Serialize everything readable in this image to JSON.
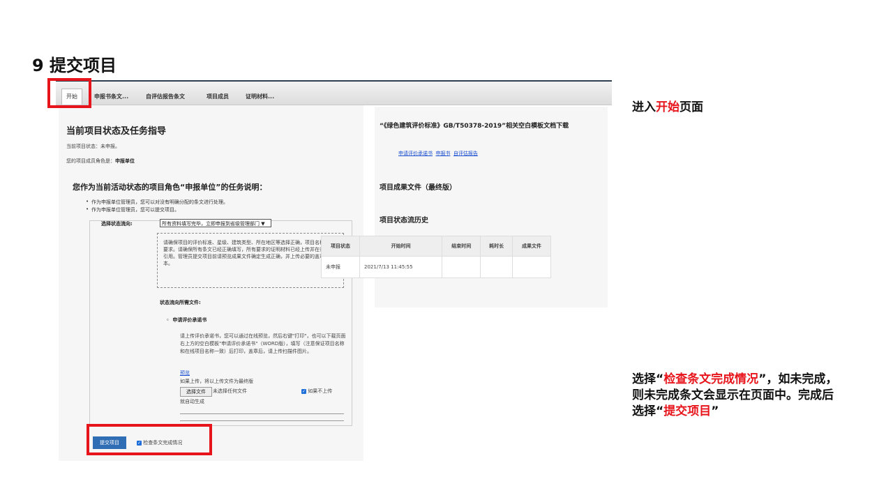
{
  "slide": {
    "title": "9 提交项目",
    "caption_top": {
      "before": "进入",
      "highlight": "开始",
      "after": "页面"
    },
    "caption_bottom": {
      "p1": "选择“",
      "h1": "检查条文完成情况",
      "p2": "”，如未完成，则未完成条文会显示在页面中。完成后选择“",
      "h2": "提交项目",
      "p3": "”"
    }
  },
  "tabs": [
    "开始",
    "申报书条文...",
    "自评估报告条文",
    "项目成员",
    "证明材料..."
  ],
  "left": {
    "heading": "当前项目状态及任务指导",
    "status": "当前项目状态：未申报。",
    "role_label": "您的项目成员角色是：",
    "role_value": "申报单位",
    "task_heading": "您作为当前活动状态的项目角色“申报单位”的任务说明：",
    "bullets": [
      "作为申报单位管理员，您可以对没有明确分配的条文进行处理。",
      "作为申报单位管理员，您可以提交项目。"
    ],
    "flow_label": "选择状态流向:",
    "flow_select": "所有资料填写完毕，立即申报到省级管理部门",
    "notice": "请确保项目的评价标准、星级、建筑类型、所在地区等选择正确，项目名称符合要求。请确保所有条文已经正确填写，所有要求的证明材料已经上传并在条文中引用。管理员提交项目前请预览成果文件确定生成正确，并上传必要的盖章版本。",
    "files_label": "状态流向所需文件:",
    "file_item": "申请评价承诺书",
    "file_desc": "请上传评价承诺书，您可以通过在线预览，然后右键\"打印\"，也可以下载页面右上方的空白模板\"申请评价承诺书\"（WORD版），填写（注意保证项目名称和在线项目名称一致）后打印，盖章后，请上传扫描件图片。",
    "preview_link": "预览",
    "upload_note": "如果上传，将以上传文件为最终版",
    "choose_file": "选择文件",
    "no_file": "未选择任何文件",
    "auto_gen_a": "如果不上传",
    "auto_gen_b": "就自动生成",
    "submit": "提交项目",
    "check": "检查条文完成情况"
  },
  "right": {
    "template_title": "“《绿色建筑评价标准》GB/T50378-2019”相关空白模板文档下载",
    "links": [
      "申请评价承诺书",
      "申报书",
      "自评估报告"
    ],
    "results_title": "项目成果文件（最终版）",
    "history_title": "项目状态流历史",
    "table_headers": [
      "项目状态",
      "开始时间",
      "结束时间",
      "耗时长",
      "成果文件"
    ],
    "table_rows": [
      [
        "未申报",
        "2021/7/13 11:45:55",
        "",
        "",
        ""
      ]
    ]
  }
}
